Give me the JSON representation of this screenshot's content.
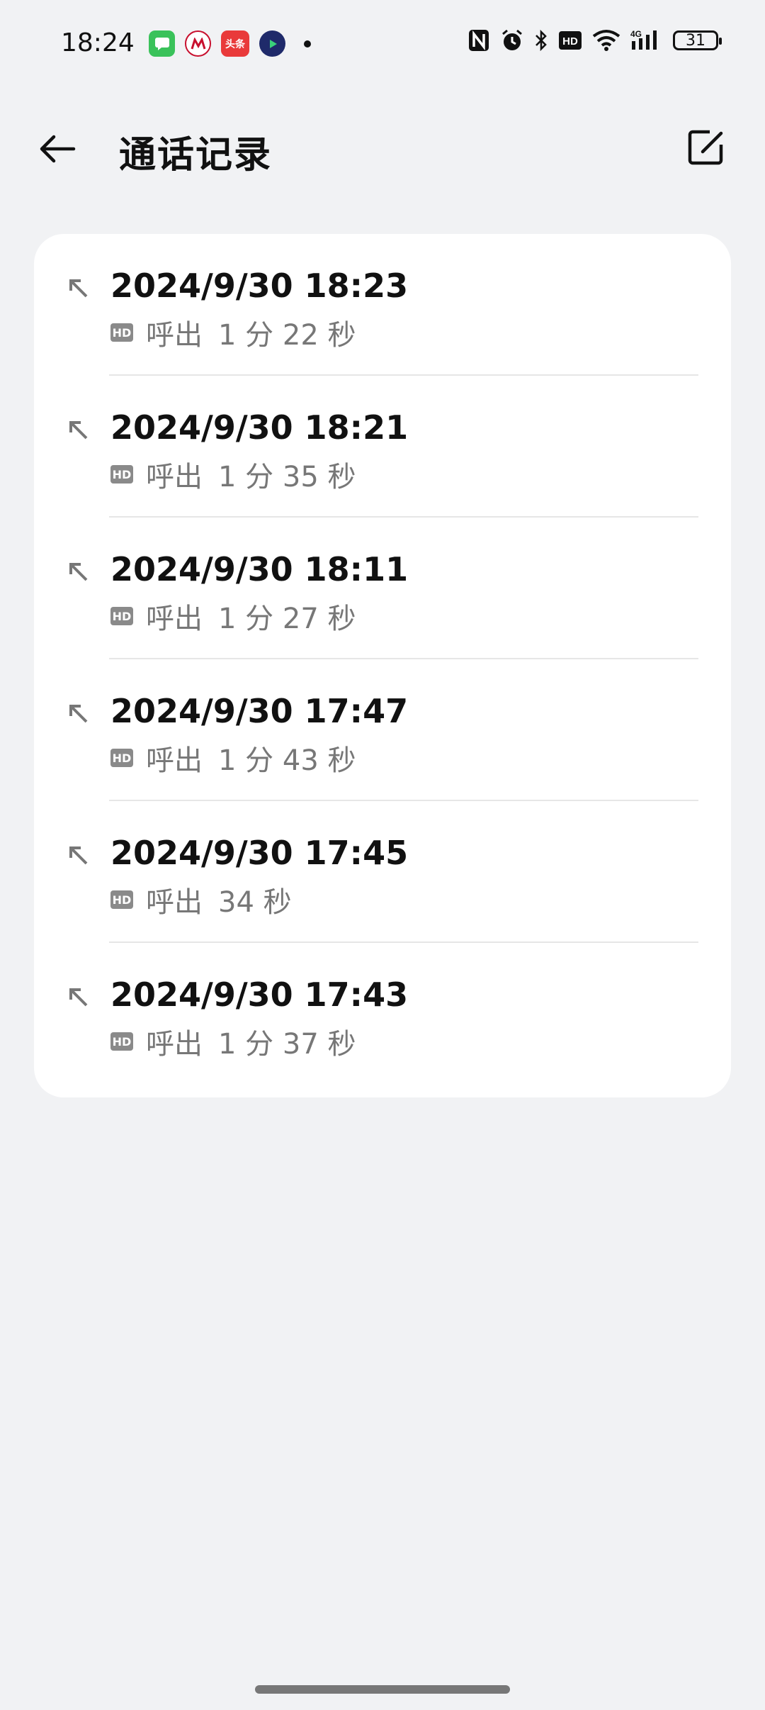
{
  "status_bar": {
    "time": "18:24",
    "notification_apps": [
      {
        "name": "messages-app-icon",
        "color": "#3ac25a"
      },
      {
        "name": "cmb-app-icon",
        "color": "#c8102e"
      },
      {
        "name": "toutiao-app-icon",
        "color": "#e93a3a",
        "text": "头条"
      },
      {
        "name": "video-app-icon",
        "color": "#1f2a6a"
      }
    ],
    "battery": "31"
  },
  "header": {
    "title": "通话记录"
  },
  "call_log": [
    {
      "date": "2024/9/30 18:23",
      "type": "呼出",
      "duration": "1 分 22 秒"
    },
    {
      "date": "2024/9/30 18:21",
      "type": "呼出",
      "duration": "1 分 35 秒"
    },
    {
      "date": "2024/9/30 18:11",
      "type": "呼出",
      "duration": "1 分 27 秒"
    },
    {
      "date": "2024/9/30 17:47",
      "type": "呼出",
      "duration": "1 分 43 秒"
    },
    {
      "date": "2024/9/30 17:45",
      "type": "呼出",
      "duration": "34 秒"
    },
    {
      "date": "2024/9/30 17:43",
      "type": "呼出",
      "duration": "1 分 37 秒"
    }
  ],
  "hd_label": "HD"
}
